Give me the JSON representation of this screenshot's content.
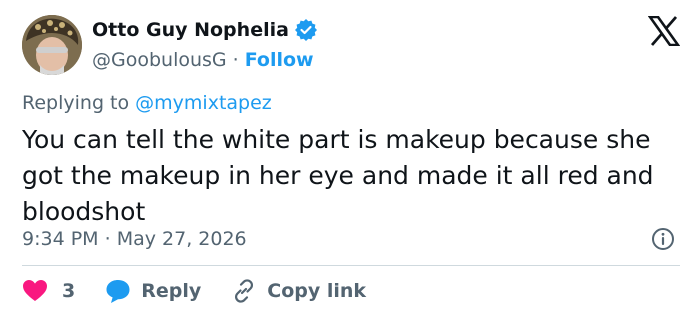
{
  "author": {
    "name": "Otto Guy Nophelia",
    "handle": "@GoobulousG",
    "separator": "·",
    "follow_label": "Follow"
  },
  "reply": {
    "prefix": "Replying to",
    "mention": "@mymixtapez"
  },
  "tweet": {
    "text": "You can tell the white part is makeup because she got the makeup in her eye and made it all red and bloodshot"
  },
  "meta": {
    "time": "9:34 PM",
    "separator": "·",
    "date": "May 27, 2026"
  },
  "actions": {
    "like_count": "3",
    "reply_label": "Reply",
    "copy_link_label": "Copy link"
  },
  "colors": {
    "accent": "#1d9bf0",
    "like": "#f91880",
    "text": "#0f1419",
    "muted": "#536471",
    "divider": "#cfd9de"
  },
  "icons": {
    "verified": "verified-badge-icon",
    "logo": "x-logo-icon",
    "info": "info-icon",
    "like": "heart-icon",
    "reply": "speech-bubble-icon",
    "copy": "link-icon"
  }
}
